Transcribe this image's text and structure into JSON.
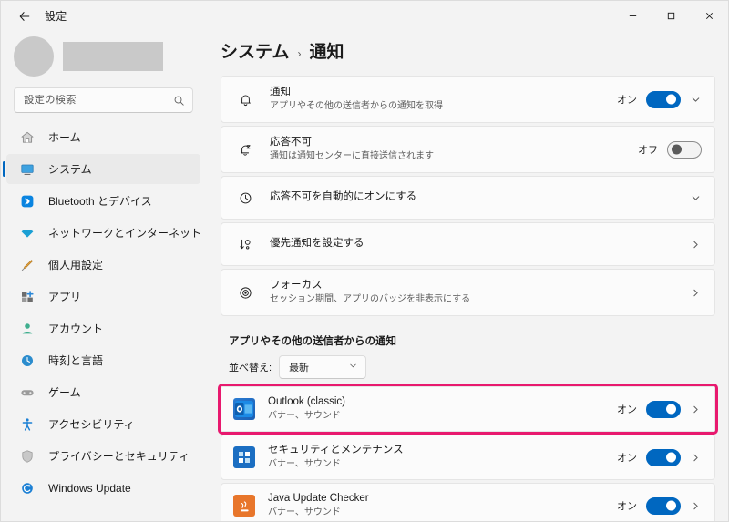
{
  "window": {
    "title": "設定",
    "back_icon": "back-arrow-icon",
    "controls": {
      "minimize": "−",
      "maximize": "□",
      "close": "✕"
    }
  },
  "sidebar": {
    "search": {
      "placeholder": "設定の検索",
      "value": "",
      "icon": "search-icon"
    },
    "items": [
      {
        "label": "ホーム",
        "icon": "home-icon",
        "active": false
      },
      {
        "label": "システム",
        "icon": "system-icon",
        "active": true
      },
      {
        "label": "Bluetooth とデバイス",
        "icon": "bluetooth-icon",
        "active": false
      },
      {
        "label": "ネットワークとインターネット",
        "icon": "network-icon",
        "active": false
      },
      {
        "label": "個人用設定",
        "icon": "personalization-icon",
        "active": false
      },
      {
        "label": "アプリ",
        "icon": "apps-icon",
        "active": false
      },
      {
        "label": "アカウント",
        "icon": "account-icon",
        "active": false
      },
      {
        "label": "時刻と言語",
        "icon": "time-language-icon",
        "active": false
      },
      {
        "label": "ゲーム",
        "icon": "gaming-icon",
        "active": false
      },
      {
        "label": "アクセシビリティ",
        "icon": "accessibility-icon",
        "active": false
      },
      {
        "label": "プライバシーとセキュリティ",
        "icon": "privacy-security-icon",
        "active": false
      },
      {
        "label": "Windows Update",
        "icon": "windows-update-icon",
        "active": false
      }
    ]
  },
  "breadcrumb": {
    "parent": "システム",
    "separator": "›",
    "current": "通知"
  },
  "settings": [
    {
      "title": "通知",
      "subtitle": "アプリやその他の送信者からの通知を取得",
      "icon": "bell-icon",
      "toggle_label": "オン",
      "toggle_state": "on",
      "trailing": "chevron-down-icon"
    },
    {
      "title": "応答不可",
      "subtitle": "通知は通知センターに直接送信されます",
      "icon": "do-not-disturb-icon",
      "toggle_label": "オフ",
      "toggle_state": "off",
      "trailing": "none"
    },
    {
      "title": "応答不可を自動的にオンにする",
      "subtitle": "",
      "icon": "clock-icon",
      "toggle_label": "",
      "toggle_state": "none",
      "trailing": "chevron-down-icon"
    },
    {
      "title": "優先通知を設定する",
      "subtitle": "",
      "icon": "priority-icon",
      "toggle_label": "",
      "toggle_state": "none",
      "trailing": "chevron-right-icon"
    },
    {
      "title": "フォーカス",
      "subtitle": "セッション期間、アプリのバッジを非表示にする",
      "icon": "focus-icon",
      "toggle_label": "",
      "toggle_state": "none",
      "trailing": "chevron-right-icon"
    }
  ],
  "apps_section": {
    "header": "アプリやその他の送信者からの通知",
    "sort_label": "並べ替え:",
    "sort_value": "最新",
    "sort_icon": "chevron-down-icon",
    "highlight_color": "#e8196e",
    "accent_color": "#0067c0",
    "apps": [
      {
        "name": "Outlook (classic)",
        "subtitle": "バナー、サウンド",
        "icon": "outlook-icon",
        "toggle_label": "オン",
        "toggle_state": "on",
        "highlighted": true
      },
      {
        "name": "セキュリティとメンテナンス",
        "subtitle": "バナー、サウンド",
        "icon": "security-maintenance-icon",
        "toggle_label": "オン",
        "toggle_state": "on",
        "highlighted": false
      },
      {
        "name": "Java Update Checker",
        "subtitle": "バナー、サウンド",
        "icon": "java-icon",
        "toggle_label": "オン",
        "toggle_state": "on",
        "highlighted": false
      }
    ]
  }
}
